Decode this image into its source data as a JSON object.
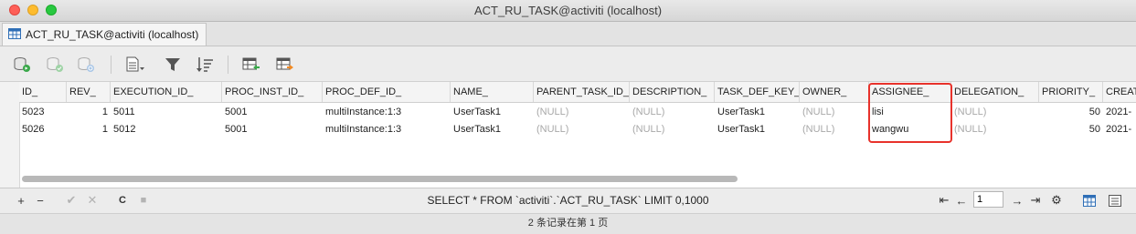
{
  "window": {
    "title": "ACT_RU_TASK@activiti (localhost)"
  },
  "tab": {
    "label": "ACT_RU_TASK@activiti (localhost)"
  },
  "toolbar": {
    "buttons": [
      "add-record-icon",
      "apply-changes-icon",
      "refresh-data-icon",
      "text-view-icon",
      "filter-icon",
      "sort-icon",
      "import-wizard-icon",
      "export-wizard-icon"
    ]
  },
  "table": {
    "columns": [
      "ID_",
      "REV_",
      "EXECUTION_ID_",
      "PROC_INST_ID_",
      "PROC_DEF_ID_",
      "NAME_",
      "PARENT_TASK_ID_",
      "DESCRIPTION_",
      "TASK_DEF_KEY_",
      "OWNER_",
      "ASSIGNEE_",
      "DELEGATION_",
      "PRIORITY_",
      "CREATE_TIME_"
    ],
    "rows": [
      [
        "5023",
        "1",
        "5011",
        "5001",
        "multiInstance:1:3",
        "UserTask1",
        "(NULL)",
        "(NULL)",
        "UserTask1",
        "(NULL)",
        "lisi",
        "(NULL)",
        "50",
        "2021-"
      ],
      [
        "5026",
        "1",
        "5012",
        "5001",
        "multiInstance:1:3",
        "UserTask1",
        "(NULL)",
        "(NULL)",
        "UserTask1",
        "(NULL)",
        "wangwu",
        "(NULL)",
        "50",
        "2021-"
      ]
    ],
    "highlight_color": "#e8322b"
  },
  "statusbar": {
    "add_label": "+",
    "remove_label": "−",
    "confirm_label": "✔",
    "cancel_label": "✕",
    "refresh_label": "C",
    "stop_label": "■",
    "sql": "SELECT * FROM `activiti`.`ACT_RU_TASK` LIMIT 0,1000",
    "page_number": "1",
    "first_label": "⇤",
    "prev_label": "←",
    "next_label": "→",
    "last_label": "⇥",
    "settings_label": "⚙"
  },
  "footer": {
    "text": "2 条记录在第 1 页"
  }
}
